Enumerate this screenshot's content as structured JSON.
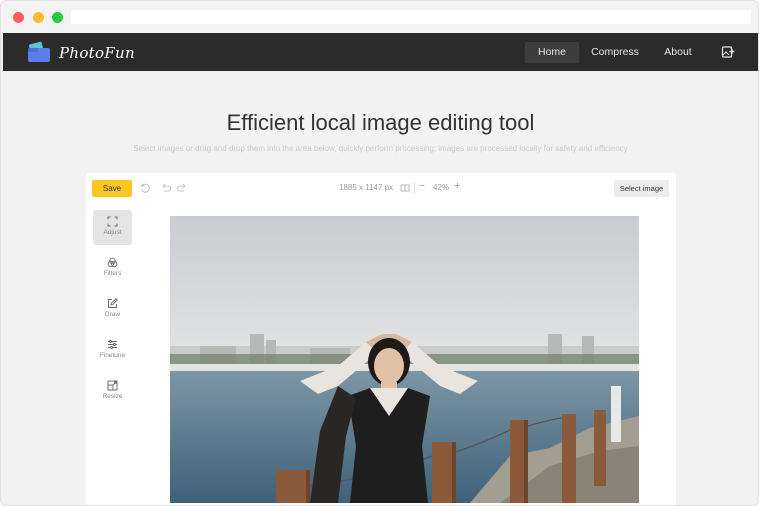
{
  "nav": {
    "brand": "PhotoFun",
    "items": [
      {
        "label": "Home",
        "active": true
      },
      {
        "label": "Compress",
        "active": false
      },
      {
        "label": "About",
        "active": false
      }
    ]
  },
  "hero": {
    "title": "Efficient local image editing tool",
    "subtitle": "Select images or drag and drop them into the area below, quickly perform processing; images are processed locally for safety and efficiency"
  },
  "toolbar": {
    "save_label": "Save",
    "dimensions": "1885 x 1147 px",
    "zoom": "42%",
    "select_label": "Select image"
  },
  "tools": [
    {
      "label": "Adjust",
      "icon": "adjust-icon",
      "active": true
    },
    {
      "label": "Filters",
      "icon": "filters-icon",
      "active": false
    },
    {
      "label": "Draw",
      "icon": "draw-icon",
      "active": false
    },
    {
      "label": "Finetune",
      "icon": "finetune-icon",
      "active": false
    },
    {
      "label": "Resize",
      "icon": "resize-icon",
      "active": false
    }
  ],
  "colors": {
    "accent": "#f9c622",
    "nav_bg": "#2b2b2b"
  }
}
